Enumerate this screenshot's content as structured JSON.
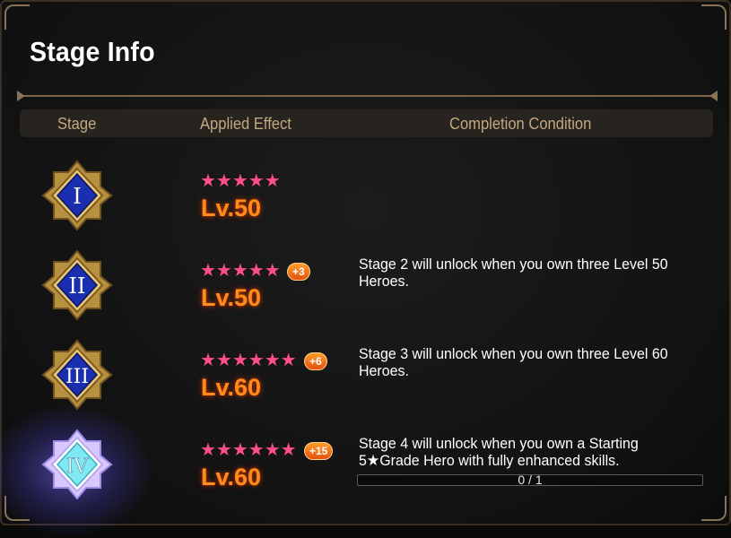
{
  "dialog": {
    "title": "Stage Info"
  },
  "header": {
    "stage": "Stage",
    "effect": "Applied Effect",
    "condition": "Completion Condition"
  },
  "stages": [
    {
      "numeral": "I",
      "stars": 5,
      "star_glyphs": "★★★★★",
      "bonus": "",
      "level": "Lv.50",
      "condition": ""
    },
    {
      "numeral": "II",
      "stars": 5,
      "star_glyphs": "★★★★★",
      "bonus": "+3",
      "level": "Lv.50",
      "condition": "Stage 2 will unlock when you own three Level 50 Heroes."
    },
    {
      "numeral": "III",
      "stars": 6,
      "star_glyphs": "★★★★★★",
      "bonus": "+6",
      "level": "Lv.60",
      "condition": "Stage 3 will unlock when you own three Level 60 Heroes."
    },
    {
      "numeral": "IV",
      "stars": 6,
      "star_glyphs": "★★★★★★",
      "bonus": "+15",
      "level": "Lv.60",
      "condition": "Stage 4 will unlock when you own a Starting 5★Grade Hero with fully enhanced skills.",
      "progress": {
        "text": "0 / 1",
        "value": 0
      }
    }
  ],
  "colors": {
    "accent_gold": "#c2a980",
    "level_orange": "#ff8b1e",
    "star_pink": "#ff4f85",
    "emblem_blue": "#1a2fb0",
    "emblem_active_cyan": "#7fe8f0"
  },
  "icons": {
    "stage_emblem": "diamond-emblem-icon",
    "star": "star-icon"
  }
}
